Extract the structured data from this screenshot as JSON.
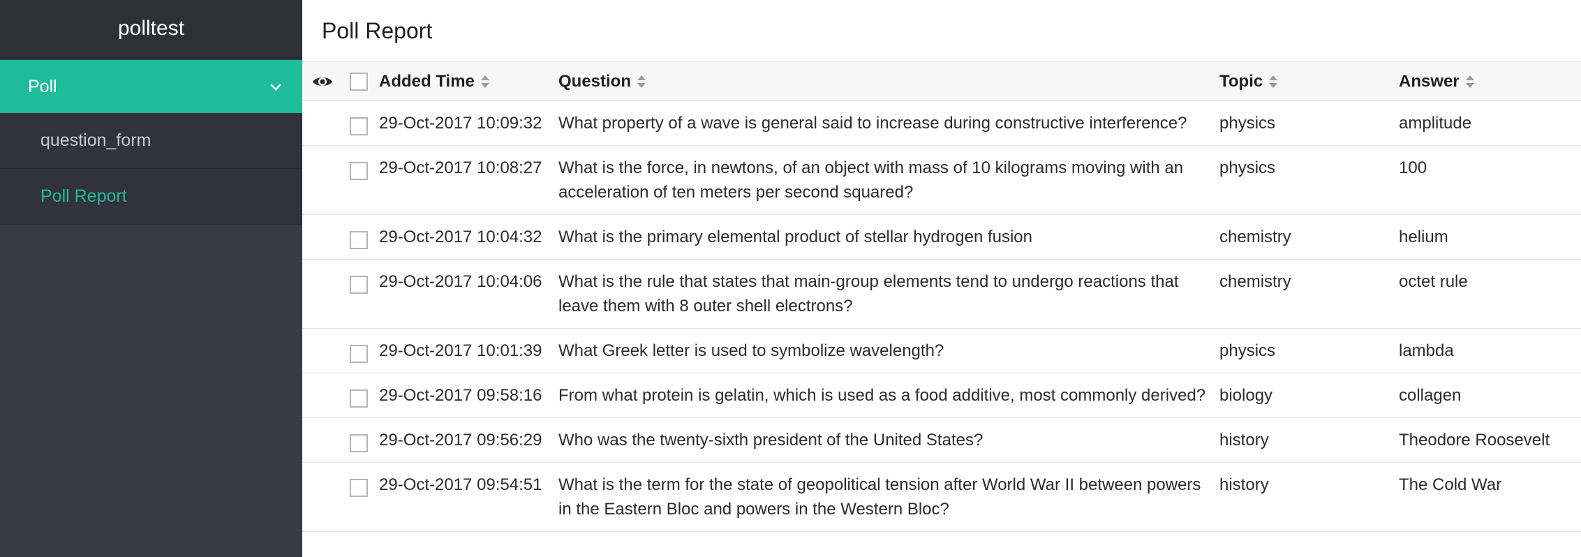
{
  "sidebar": {
    "brand": "polltest",
    "group_label": "Poll",
    "items": [
      {
        "label": "question_form"
      },
      {
        "label": "Poll Report"
      }
    ]
  },
  "main": {
    "title": "Poll Report"
  },
  "table": {
    "columns": {
      "added_time": "Added Time",
      "question": "Question",
      "topic": "Topic",
      "answer": "Answer"
    },
    "rows": [
      {
        "added_time": "29-Oct-2017 10:09:32",
        "question": "What property of a wave is general said to increase during constructive interference?",
        "topic": "physics",
        "answer": "amplitude"
      },
      {
        "added_time": "29-Oct-2017 10:08:27",
        "question": "What is the force, in newtons, of an object with mass of 10 kilograms moving with an acceleration of ten meters per second squared?",
        "topic": "physics",
        "answer": "100"
      },
      {
        "added_time": "29-Oct-2017 10:04:32",
        "question": "What is the primary elemental product of stellar hydrogen fusion",
        "topic": "chemistry",
        "answer": "helium"
      },
      {
        "added_time": "29-Oct-2017 10:04:06",
        "question": "What is the rule that states that main-group elements tend to undergo reactions that leave them with 8 outer shell electrons?",
        "topic": "chemistry",
        "answer": "octet rule"
      },
      {
        "added_time": "29-Oct-2017 10:01:39",
        "question": "What Greek letter is used to symbolize wavelength?",
        "topic": "physics",
        "answer": "lambda"
      },
      {
        "added_time": "29-Oct-2017 09:58:16",
        "question": "From what protein is gelatin, which is used as a food additive, most commonly derived?",
        "topic": "biology",
        "answer": "collagen"
      },
      {
        "added_time": "29-Oct-2017 09:56:29",
        "question": "Who was the twenty-sixth president of the United States?",
        "topic": "history",
        "answer": "Theodore Roosevelt"
      },
      {
        "added_time": "29-Oct-2017 09:54:51",
        "question": "What is the term for the state of geopolitical tension after World War II between powers in the Eastern Bloc and powers in the Western Bloc?",
        "topic": "history",
        "answer": "The Cold War"
      }
    ]
  }
}
